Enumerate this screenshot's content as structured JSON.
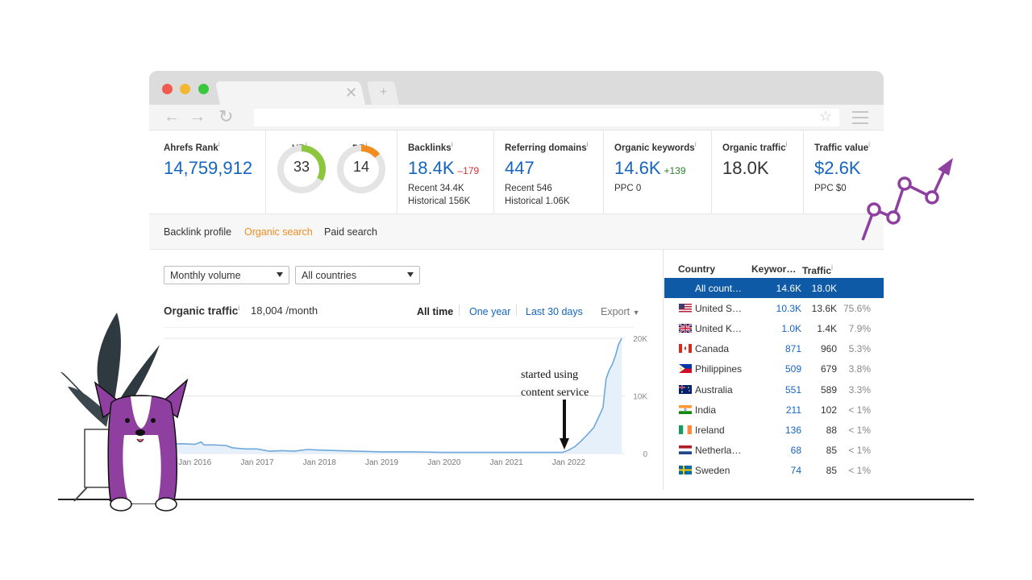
{
  "metrics": {
    "ahrefs_rank": {
      "label": "Ahrefs Rank",
      "info": "i",
      "value": "14,759,912"
    },
    "ur": {
      "label": "UR",
      "info": "i",
      "value": "33",
      "color": "#8cc63f",
      "fraction": 0.33
    },
    "dr": {
      "label": "DR",
      "info": "i",
      "value": "14",
      "color": "#f28c1e",
      "fraction": 0.14
    },
    "backlinks": {
      "label": "Backlinks",
      "info": "i",
      "value": "18.4K",
      "delta": "–179",
      "recent": "Recent 34.4K",
      "historical": "Historical 156K"
    },
    "referring_domains": {
      "label": "Referring domains",
      "info": "i",
      "value": "447",
      "recent": "Recent 546",
      "historical": "Historical 1.06K"
    },
    "organic_keywords": {
      "label": "Organic keywords",
      "info": "i",
      "value": "14.6K",
      "delta": "+139",
      "ppc": "PPC 0"
    },
    "organic_traffic": {
      "label": "Organic traffic",
      "info": "i",
      "value": "18.0K"
    },
    "traffic_value": {
      "label": "Traffic value",
      "info": "i",
      "value": "$2.6K",
      "ppc": "PPC $0"
    }
  },
  "tabs": [
    {
      "label": "Backlink profile"
    },
    {
      "label": "Organic search"
    },
    {
      "label": "Paid search"
    }
  ],
  "filters": {
    "volume": "Monthly volume",
    "countries": "All countries"
  },
  "traffic": {
    "title": "Organic traffic",
    "info": "i",
    "value": "18,004 /month",
    "ranges": [
      "All time",
      "One year",
      "Last 30 days"
    ],
    "export": "Export"
  },
  "annotation": {
    "line1": "started using",
    "line2": "content service"
  },
  "colors": {
    "accent": "#1565c0",
    "active_tab": "#f28c1e",
    "selected_row": "#0e5aa7",
    "line": "#6fa8dc",
    "delta_negative": "#d32f2f",
    "delta_positive": "#2e7d32",
    "doodle": "#8e3fa0"
  },
  "chart_data": {
    "type": "area",
    "x_labels": [
      "Jan 2016",
      "Jan 2017",
      "Jan 2018",
      "Jan 2019",
      "Jan 2020",
      "Jan 2021",
      "Jan 2022"
    ],
    "y_ticks": [
      "20K",
      "10K",
      "0"
    ],
    "ylim": [
      0,
      20000
    ],
    "xlim": [
      2015.5,
      2022.9
    ],
    "grid": true,
    "series": [
      {
        "x": [
          2015.5,
          2015.8,
          2016.0,
          2016.1,
          2016.15,
          2016.3,
          2016.5,
          2016.6,
          2016.8,
          2017.0,
          2017.2,
          2017.4,
          2017.6,
          2017.8,
          2018.0,
          2018.3,
          2018.6,
          2019.0,
          2019.5,
          2020.0,
          2020.5,
          2021.0,
          2021.4,
          2021.6,
          2021.8,
          2021.9,
          2022.0,
          2022.1,
          2022.2,
          2022.3,
          2022.4,
          2022.5,
          2022.55,
          2022.6,
          2022.65,
          2022.7,
          2022.75,
          2022.8,
          2022.85
        ],
        "y": [
          1600,
          1700,
          1600,
          2000,
          1500,
          1500,
          1400,
          1000,
          800,
          800,
          400,
          500,
          400,
          700,
          600,
          500,
          400,
          300,
          300,
          200,
          200,
          200,
          200,
          200,
          200,
          200,
          600,
          1200,
          2200,
          3300,
          4500,
          6800,
          8000,
          13000,
          14500,
          15500,
          17000,
          19000,
          20000
        ]
      }
    ]
  },
  "country_table": {
    "headers": {
      "country": "Country",
      "keywords": "Keywor…",
      "traffic": "Traffic",
      "info": "i"
    },
    "rows": [
      {
        "name": "All count…",
        "keywords": "14.6K",
        "traffic": "18.0K",
        "pct": "",
        "flag": "none"
      },
      {
        "name": "United S…",
        "keywords": "10.3K",
        "traffic": "13.6K",
        "pct": "75.6%",
        "flag": "us"
      },
      {
        "name": "United K…",
        "keywords": "1.0K",
        "traffic": "1.4K",
        "pct": "7.9%",
        "flag": "uk"
      },
      {
        "name": "Canada",
        "keywords": "871",
        "traffic": "960",
        "pct": "5.3%",
        "flag": "ca"
      },
      {
        "name": "Philippines",
        "keywords": "509",
        "traffic": "679",
        "pct": "3.8%",
        "flag": "ph"
      },
      {
        "name": "Australia",
        "keywords": "551",
        "traffic": "589",
        "pct": "3.3%",
        "flag": "au"
      },
      {
        "name": "India",
        "keywords": "211",
        "traffic": "102",
        "pct": "< 1%",
        "flag": "in"
      },
      {
        "name": "Ireland",
        "keywords": "136",
        "traffic": "88",
        "pct": "< 1%",
        "flag": "ie"
      },
      {
        "name": "Netherla…",
        "keywords": "68",
        "traffic": "85",
        "pct": "< 1%",
        "flag": "nl"
      },
      {
        "name": "Sweden",
        "keywords": "74",
        "traffic": "85",
        "pct": "< 1%",
        "flag": "se"
      }
    ]
  }
}
